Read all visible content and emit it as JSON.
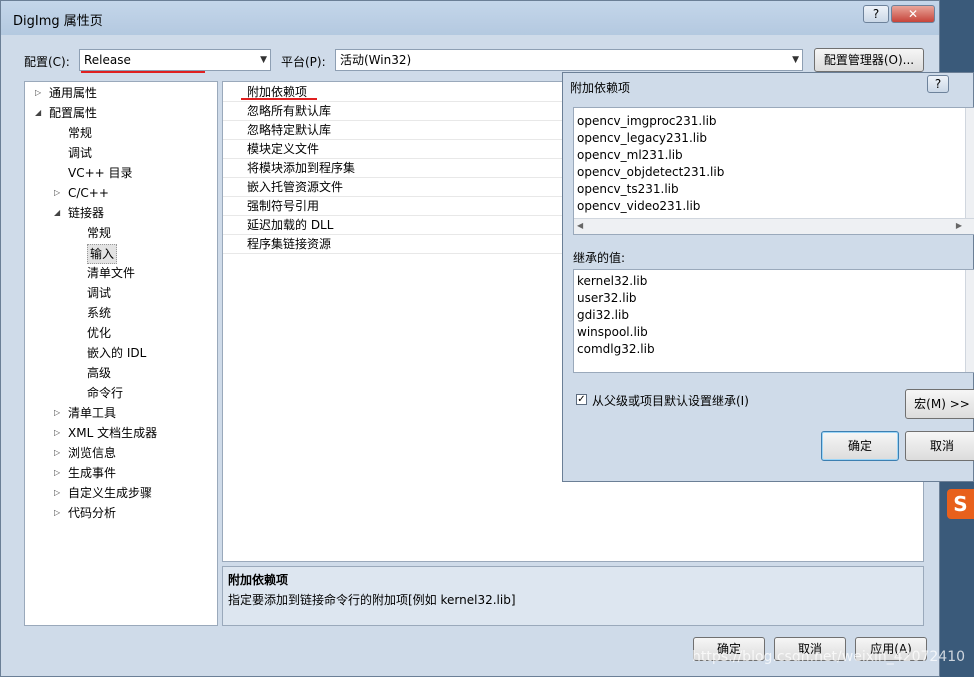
{
  "window": {
    "title": "DigImg 属性页",
    "help": "?",
    "close": "✕"
  },
  "config": {
    "label": "配置(C):",
    "value": "Release",
    "platform_label": "平台(P):",
    "platform_value": "活动(Win32)",
    "manager_button": "配置管理器(O)..."
  },
  "tree": {
    "items": [
      {
        "label": "通用属性",
        "toggle": "▷"
      },
      {
        "label": "配置属性",
        "toggle": "◢"
      },
      {
        "label": "常规",
        "toggle": ""
      },
      {
        "label": "调试",
        "toggle": ""
      },
      {
        "label": "VC++ 目录",
        "toggle": ""
      },
      {
        "label": "C/C++",
        "toggle": "▷"
      },
      {
        "label": "链接器",
        "toggle": "◢"
      },
      {
        "label": "常规",
        "toggle": ""
      },
      {
        "label": "输入",
        "toggle": ""
      },
      {
        "label": "清单文件",
        "toggle": ""
      },
      {
        "label": "调试",
        "toggle": ""
      },
      {
        "label": "系统",
        "toggle": ""
      },
      {
        "label": "优化",
        "toggle": ""
      },
      {
        "label": "嵌入的 IDL",
        "toggle": ""
      },
      {
        "label": "高级",
        "toggle": ""
      },
      {
        "label": "命令行",
        "toggle": ""
      },
      {
        "label": "清单工具",
        "toggle": "▷"
      },
      {
        "label": "XML 文档生成器",
        "toggle": "▷"
      },
      {
        "label": "浏览信息",
        "toggle": "▷"
      },
      {
        "label": "生成事件",
        "toggle": "▷"
      },
      {
        "label": "自定义生成步骤",
        "toggle": "▷"
      },
      {
        "label": "代码分析",
        "toggle": "▷"
      }
    ]
  },
  "grid": {
    "rows": [
      "附加依赖项",
      "忽略所有默认库",
      "忽略特定默认库",
      "模块定义文件",
      "将模块添加到程序集",
      "嵌入托管资源文件",
      "强制符号引用",
      "延迟加载的 DLL",
      "程序集链接资源"
    ]
  },
  "description": {
    "title": "附加依赖项",
    "text": "指定要添加到链接命令行的附加项[例如 kernel32.lib]"
  },
  "buttons": {
    "ok": "确定",
    "cancel": "取消",
    "apply": "应用(A)"
  },
  "dialog": {
    "title": "附加依赖项",
    "help": "?",
    "entries": [
      "opencv_imgproc231.lib",
      "opencv_legacy231.lib",
      "opencv_ml231.lib",
      "opencv_objdetect231.lib",
      "opencv_ts231.lib",
      "opencv_video231.lib"
    ],
    "inherited_label": "继承的值:",
    "inherited": [
      "kernel32.lib",
      "user32.lib",
      "gdi32.lib",
      "winspool.lib",
      "comdlg32.lib"
    ],
    "inherit_checkbox": "从父级或项目默认设置继承(I)",
    "inherit_checked": true,
    "macro_button": "宏(M) >>",
    "ok": "确定",
    "cancel": "取消"
  },
  "watermark": "https://blog.csdn.net/weixin_42072410"
}
